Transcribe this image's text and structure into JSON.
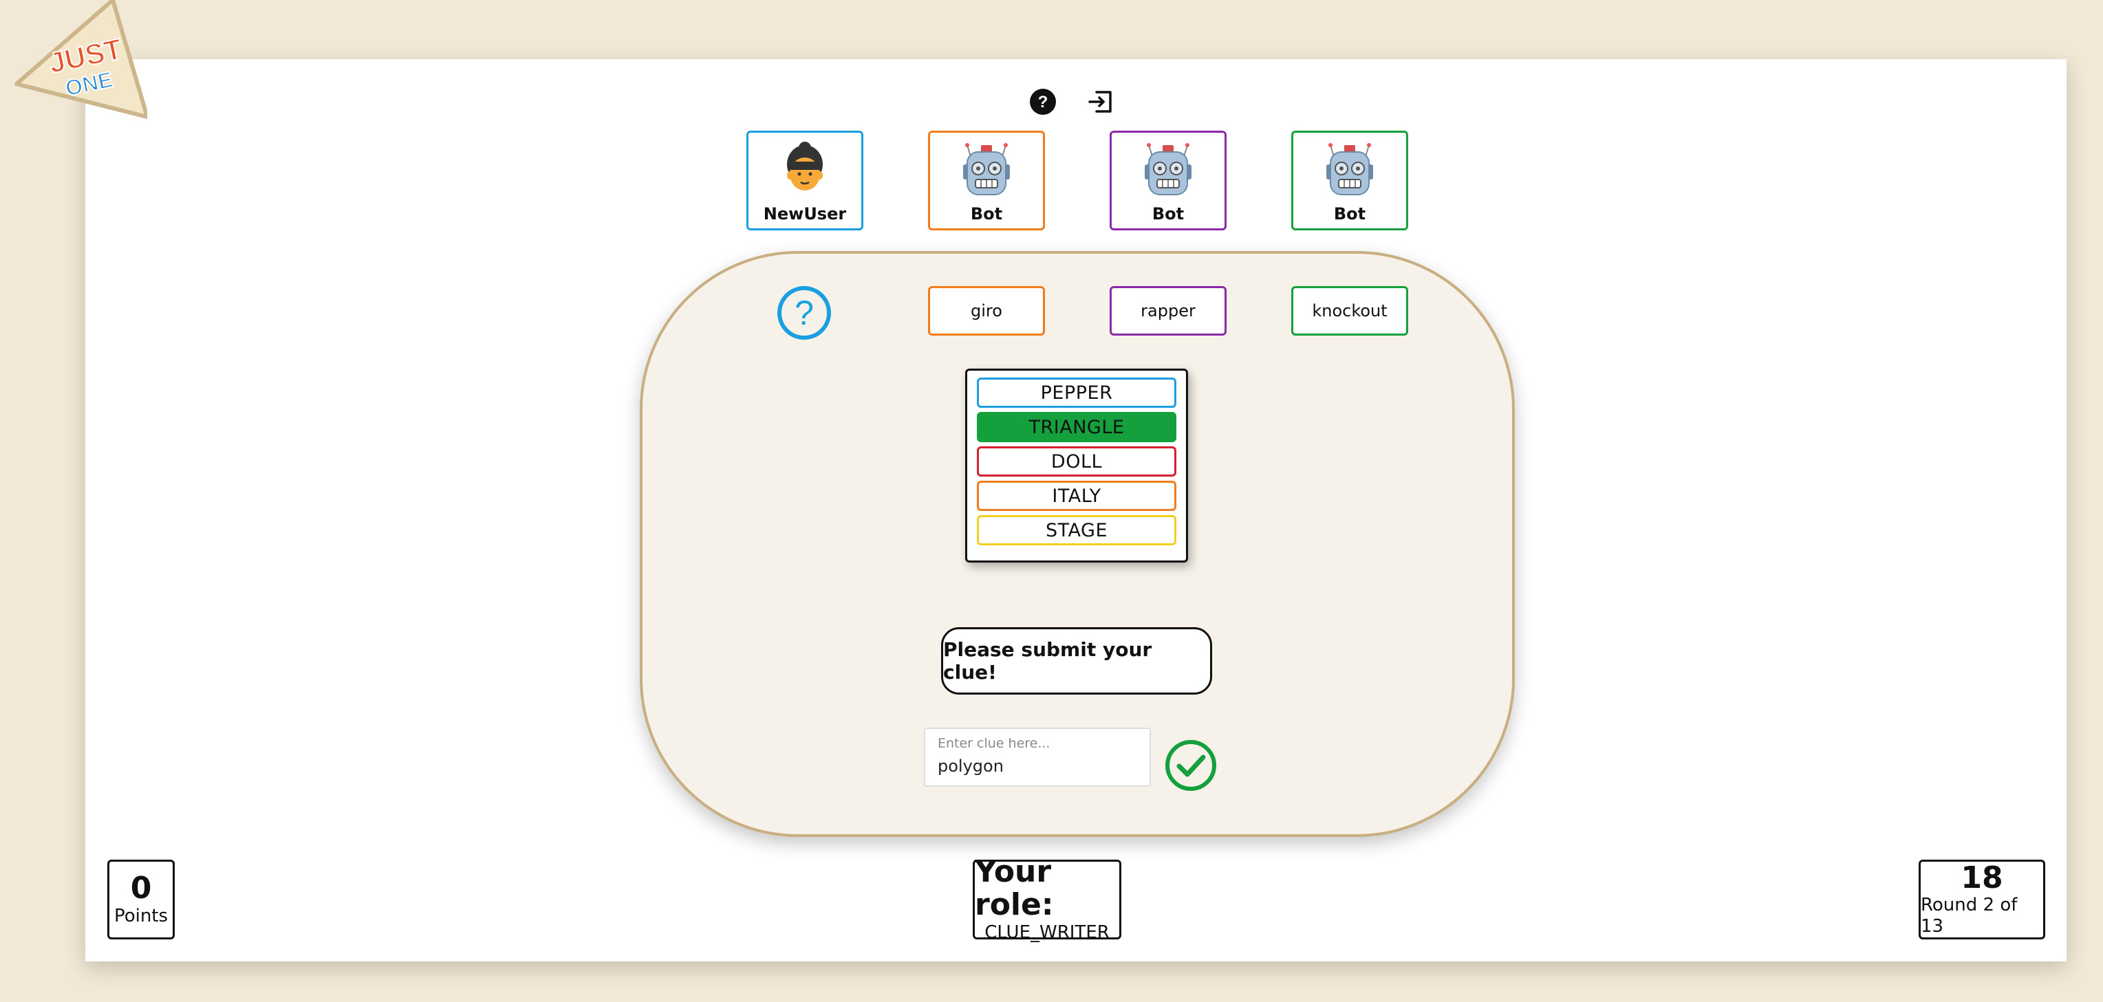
{
  "logo": {
    "line1": "JUST",
    "line2": "ONE"
  },
  "header": {
    "help_icon": "help-circle-icon",
    "exit_icon": "exit-icon"
  },
  "players": [
    {
      "name": "NewUser",
      "avatar": "user-face-icon",
      "color": "#1aa0e0"
    },
    {
      "name": "Bot",
      "avatar": "robot-icon",
      "color": "#f07c1c"
    },
    {
      "name": "Bot",
      "avatar": "robot-icon",
      "color": "#8a2aa8"
    },
    {
      "name": "Bot",
      "avatar": "robot-icon",
      "color": "#14a03c"
    }
  ],
  "clues": [
    {
      "text": "giro",
      "color": "#f07c1c"
    },
    {
      "text": "rapper",
      "color": "#8a2aa8"
    },
    {
      "text": "knockout",
      "color": "#14a03c"
    }
  ],
  "word_card": {
    "words": [
      {
        "text": "PEPPER",
        "color": "#1aa0e0",
        "selected": false
      },
      {
        "text": "TRIANGLE",
        "color": "#14a03c",
        "selected": true
      },
      {
        "text": "DOLL",
        "color": "#d42030",
        "selected": false
      },
      {
        "text": "ITALY",
        "color": "#f07c1c",
        "selected": false
      },
      {
        "text": "STAGE",
        "color": "#f0d020",
        "selected": false
      }
    ]
  },
  "prompt": "Please submit your clue!",
  "clue_input": {
    "placeholder": "Enter clue here...",
    "value": "polygon"
  },
  "stats": {
    "points_value": "0",
    "points_label": "Points",
    "role_title": "Your role:",
    "role_value": "CLUE_WRITER",
    "timer_value": "18",
    "round_label": "Round 2 of 13"
  }
}
